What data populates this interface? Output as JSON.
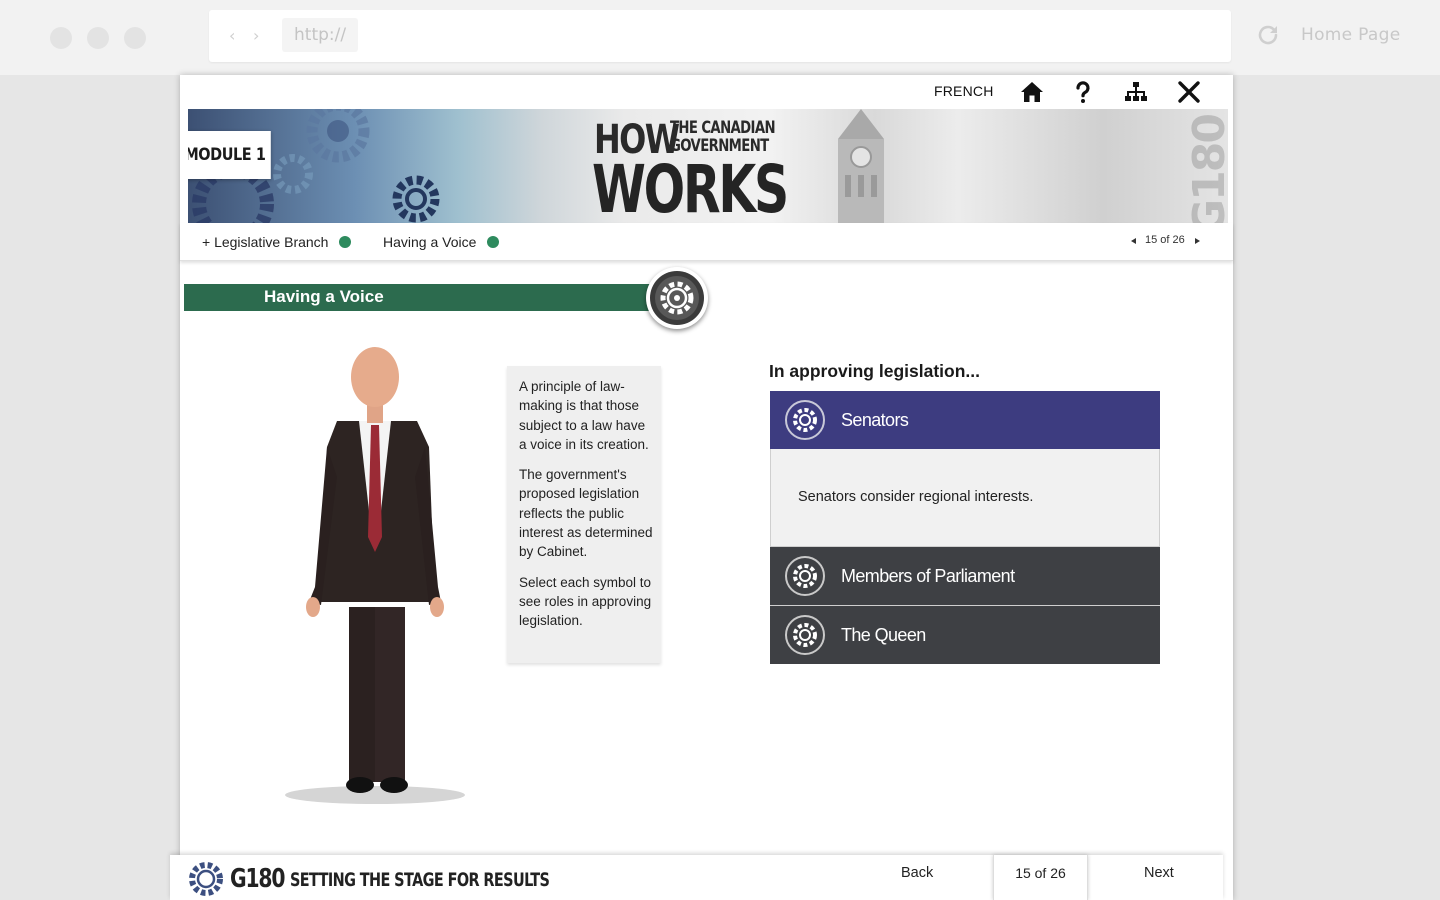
{
  "browser": {
    "url": "http://",
    "home_label": "Home Page"
  },
  "topbar": {
    "language_label": "FRENCH"
  },
  "banner": {
    "module_label": "MODULE 1",
    "title_how": "HOW",
    "title_canadian_line1": "THE CANADIAN",
    "title_canadian_line2": "GOVERNMENT",
    "title_works": "WORKS",
    "side_mark": "G180"
  },
  "breadcrumb": {
    "item1": "+ Legislative Branch",
    "item2": "Having a Voice",
    "pager": "15 of 26"
  },
  "section": {
    "title": "Having a Voice"
  },
  "note": {
    "p1": "A principle of law-making is that those subject to a law have a voice in its creation.",
    "p2": "The government's proposed legislation reflects the public interest as determined by Cabinet.",
    "p3": "Select each symbol to see roles in approving legislation."
  },
  "accordion": {
    "intro": "In approving legislation...",
    "items": [
      {
        "label": "Senators",
        "body": "Senators consider regional interests."
      },
      {
        "label": "Members of Parliament"
      },
      {
        "label": "The Queen"
      }
    ]
  },
  "footer": {
    "brand": "G180",
    "tagline": "SETTING THE STAGE FOR RESULTS",
    "back_label": "Back",
    "page_count": "15 of 26",
    "next_label": "Next"
  },
  "colors": {
    "section_green": "#2c6b4e",
    "status_dot_green": "#2e8b5e",
    "active_item_purple": "#3d3c80",
    "inactive_item_gray": "#3e4044"
  }
}
